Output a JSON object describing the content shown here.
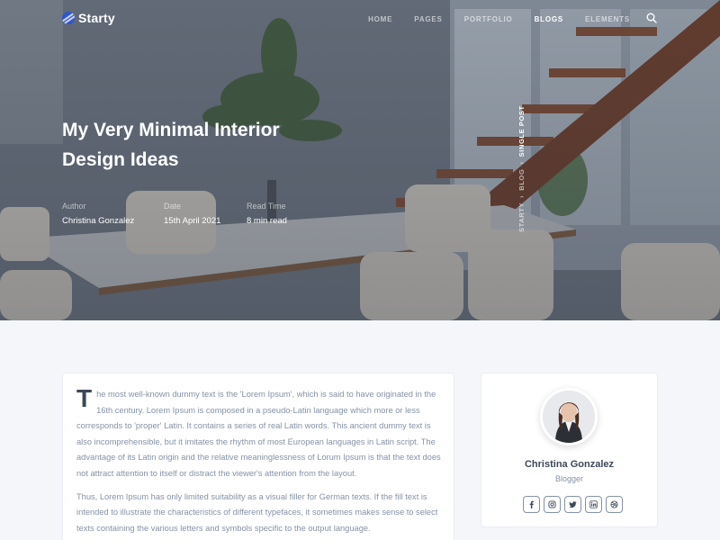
{
  "brand": {
    "name": "Starty"
  },
  "nav": {
    "items": [
      {
        "label": "HOME",
        "active": false
      },
      {
        "label": "PAGES",
        "active": false
      },
      {
        "label": "PORTFOLIO",
        "active": false
      },
      {
        "label": "BLOGS",
        "active": true
      },
      {
        "label": "ELEMENTS",
        "active": false
      }
    ],
    "search_icon": "search-icon"
  },
  "hero": {
    "title": "My Very Minimal Interior Design Ideas",
    "meta": {
      "author_label": "Author",
      "author": "Christina Gonzalez",
      "date_label": "Date",
      "date": "15th April 2021",
      "read_label": "Read Time",
      "read_time": "8 min read"
    },
    "breadcrumb": [
      "STARTY",
      "BLOG",
      "SINGLE POST"
    ]
  },
  "article": {
    "dropcap": "T",
    "paragraph1": "he most well-known dummy text is the 'Lorem Ipsum', which is said to have originated in the 16th century. Lorem Ipsum is composed in a pseudo-Latin language which more or less corresponds to 'proper' Latin. It contains a series of real Latin words. This ancient dummy text is also incomprehensible, but it imitates the rhythm of most European languages in Latin script. The advantage of its Latin origin and the relative meaninglessness of Lorum Ipsum is that the text does not attract attention to itself or distract the viewer's attention from the layout.",
    "paragraph2": "Thus, Lorem Ipsum has only limited suitability as a visual filler for German texts. If the fill text is intended to illustrate the characteristics of different typefaces, it sometimes makes sense to select texts containing the various letters and symbols specific to the output language."
  },
  "author_card": {
    "name": "Christina Gonzalez",
    "role": "Blogger",
    "socials": [
      "facebook-icon",
      "instagram-icon",
      "twitter-icon",
      "linkedin-icon",
      "dribbble-icon"
    ]
  },
  "colors": {
    "accent": "#2f55d4",
    "text_dark": "#3c4858",
    "text_muted": "#8492a6",
    "page_bg": "#f4f6f9"
  }
}
